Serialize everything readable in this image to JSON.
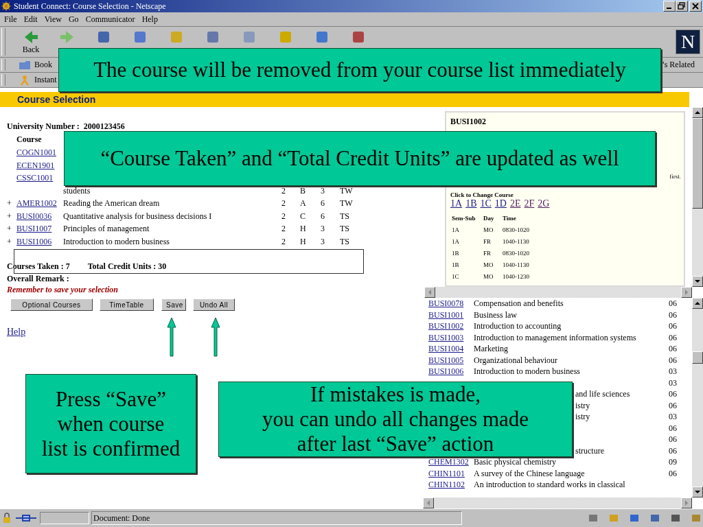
{
  "window": {
    "title": "Student Connect: Course Selection - Netscape"
  },
  "menu": [
    {
      "label": "File"
    },
    {
      "label": "Edit"
    },
    {
      "label": "View"
    },
    {
      "label": "Go"
    },
    {
      "label": "Communicator"
    },
    {
      "label": "Help"
    }
  ],
  "toolbar": {
    "first_label": "Back",
    "logo": "N"
  },
  "bookmarks_bar": {
    "left": "Book",
    "right": "’s Related"
  },
  "instant_bar": {
    "label": "Instant"
  },
  "page": {
    "header": "Course Selection",
    "university_number_label": "University Number :",
    "university_number": "2000123456",
    "course_heading": "Course",
    "rows": [
      {
        "code": "COGN1001"
      },
      {
        "code": "ECEN1901"
      },
      {
        "code": "CSSC1001"
      },
      {
        "desc": "students",
        "sem": "2",
        "sub": "B",
        "units": "3",
        "type": "TW"
      },
      {
        "marker": "+",
        "code": "AMER1002",
        "desc": "Reading the American dream",
        "sem": "2",
        "sub": "A",
        "units": "6",
        "type": "TW"
      },
      {
        "marker": "+",
        "code": "BUSI0036",
        "desc": "Quantitative analysis for business decisions I",
        "sem": "2",
        "sub": "C",
        "units": "6",
        "type": "TS"
      },
      {
        "marker": "+",
        "code": "BUSI1007",
        "desc": "Principles of management",
        "sem": "2",
        "sub": "H",
        "units": "3",
        "type": "TS"
      },
      {
        "marker": "+",
        "code": "BUSI1006",
        "desc": "Introduction to modern business",
        "sem": "2",
        "sub": "H",
        "units": "3",
        "type": "TS"
      }
    ],
    "courses_taken": "Courses Taken : 7",
    "total_credit": "Total Credit Units : 30",
    "overall_remark": "Overall Remark :",
    "reminder": "Remember to save your selection",
    "buttons": [
      {
        "label": "Optional Courses"
      },
      {
        "label": "TimeTable"
      },
      {
        "label": "Save"
      },
      {
        "label": "Undo All"
      }
    ],
    "help": "Help"
  },
  "detail": {
    "code": "BUSI1002",
    "note": "first.",
    "change_label": "Click to Change Course",
    "sections": [
      {
        "label": "1A",
        "visited": false
      },
      {
        "label": "1B",
        "visited": false
      },
      {
        "label": "1C",
        "visited": false
      },
      {
        "label": "1D",
        "visited": false
      },
      {
        "label": "2E",
        "visited": true
      },
      {
        "label": "2F",
        "visited": true
      },
      {
        "label": "2G",
        "visited": true
      }
    ],
    "columns": [
      "Sem-Sub",
      "Day",
      "Time"
    ],
    "schedule": [
      [
        "1A",
        "MO",
        "0830-1020"
      ],
      [
        "1A",
        "FR",
        "1040-1130"
      ],
      [
        "1B",
        "FR",
        "0830-1020"
      ],
      [
        "1B",
        "MO",
        "1040-1130"
      ],
      [
        "1C",
        "MO",
        "1040-1230"
      ]
    ]
  },
  "course_list": [
    {
      "kind": "full",
      "code": "BUSI0078",
      "title": "Compensation and benefits",
      "units": "06"
    },
    {
      "kind": "full",
      "code": "BUSI1001",
      "title": "Business law",
      "units": "06"
    },
    {
      "kind": "full",
      "code": "BUSI1002",
      "title": "Introduction to accounting",
      "units": "06"
    },
    {
      "kind": "full",
      "code": "BUSI1003",
      "title": "Introduction to management information systems",
      "units": "06"
    },
    {
      "kind": "full",
      "code": "BUSI1004",
      "title": "Marketing",
      "units": "06"
    },
    {
      "kind": "full",
      "code": "BUSI1005",
      "title": "Organizational behaviour",
      "units": "06"
    },
    {
      "kind": "full",
      "code": "BUSI1006",
      "title": "Introduction to modern business",
      "units": "03"
    },
    {
      "kind": "partial",
      "units": "03"
    },
    {
      "kind": "partial",
      "title": "and life sciences",
      "units": "06"
    },
    {
      "kind": "partial",
      "title": "istry",
      "units": "06"
    },
    {
      "kind": "partial",
      "title": "istry",
      "units": "03"
    },
    {
      "kind": "partial",
      "units": "06"
    },
    {
      "kind": "partial",
      "units": "06"
    },
    {
      "kind": "partial",
      "title": "structure",
      "units": "06"
    },
    {
      "kind": "full",
      "code": "CHEM1302",
      "title": "Basic physical chemistry",
      "units": "09"
    },
    {
      "kind": "full",
      "code": "CHIN1101",
      "title": "A survey of the Chinese language",
      "units": "06"
    },
    {
      "kind": "full",
      "code": "CHIN1102",
      "title": "An introduction to standard works in classical"
    }
  ],
  "status_bar": {
    "text": "Document: Done"
  },
  "callouts": [
    {
      "lines": [
        "The course will be removed from your course list immediately"
      ]
    },
    {
      "lines": [
        "“Course Taken” and “Total Credit Units” are updated as well"
      ]
    },
    {
      "lines": [
        "Press “Save”",
        "when course",
        "list is confirmed"
      ]
    },
    {
      "lines": [
        "If mistakes is made,",
        "you can undo all changes made",
        "after last “Save” action"
      ]
    }
  ]
}
